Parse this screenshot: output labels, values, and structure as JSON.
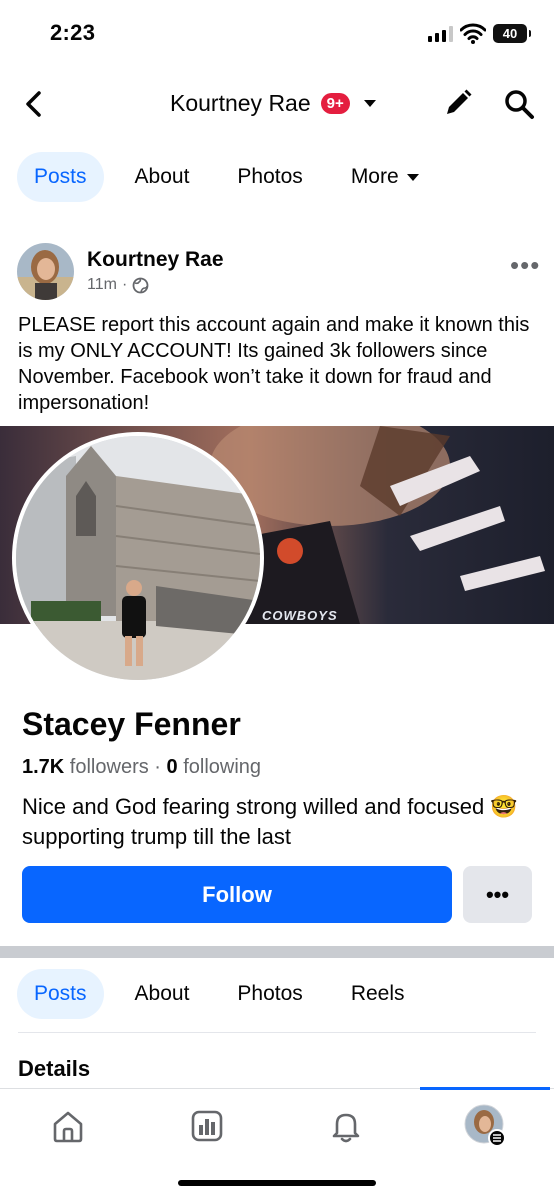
{
  "status_bar": {
    "time": "2:23",
    "battery": "40"
  },
  "header": {
    "title": "Kourtney Rae",
    "badge": "9+"
  },
  "top_tabs": [
    {
      "label": "Posts",
      "active": true
    },
    {
      "label": "About",
      "active": false
    },
    {
      "label": "Photos",
      "active": false
    },
    {
      "label": "More",
      "active": false
    }
  ],
  "post": {
    "author": "Kourtney Rae",
    "time": "11m",
    "separator": "·",
    "more": "•••",
    "text": "PLEASE report this account again and make it known this is my ONLY ACCOUNT! Its gained 3k followers since November. Facebook won’t take it down for fraud and impersonation!"
  },
  "shared_profile": {
    "name": "Stacey Fenner",
    "followers_count": "1.7K",
    "followers_label": " followers",
    "dot": " · ",
    "following_count": "0",
    "following_label": " following",
    "bio": "Nice and God fearing strong willed and focused 🤓 supporting trump till the last",
    "follow_button": "Follow",
    "more_button": "•••",
    "cover_text": "COWBOYS"
  },
  "bottom_tabs": [
    {
      "label": "Posts",
      "active": true
    },
    {
      "label": "About",
      "active": false
    },
    {
      "label": "Photos",
      "active": false
    },
    {
      "label": "Reels",
      "active": false
    }
  ],
  "details_label": "Details",
  "colors": {
    "brand_blue": "#0866ff",
    "badge_red": "#e41e3f",
    "tab_active_bg": "#e7f3ff"
  },
  "bottom_nav": [
    "home-icon",
    "dashboard-icon",
    "bell-icon",
    "profile-avatar"
  ]
}
